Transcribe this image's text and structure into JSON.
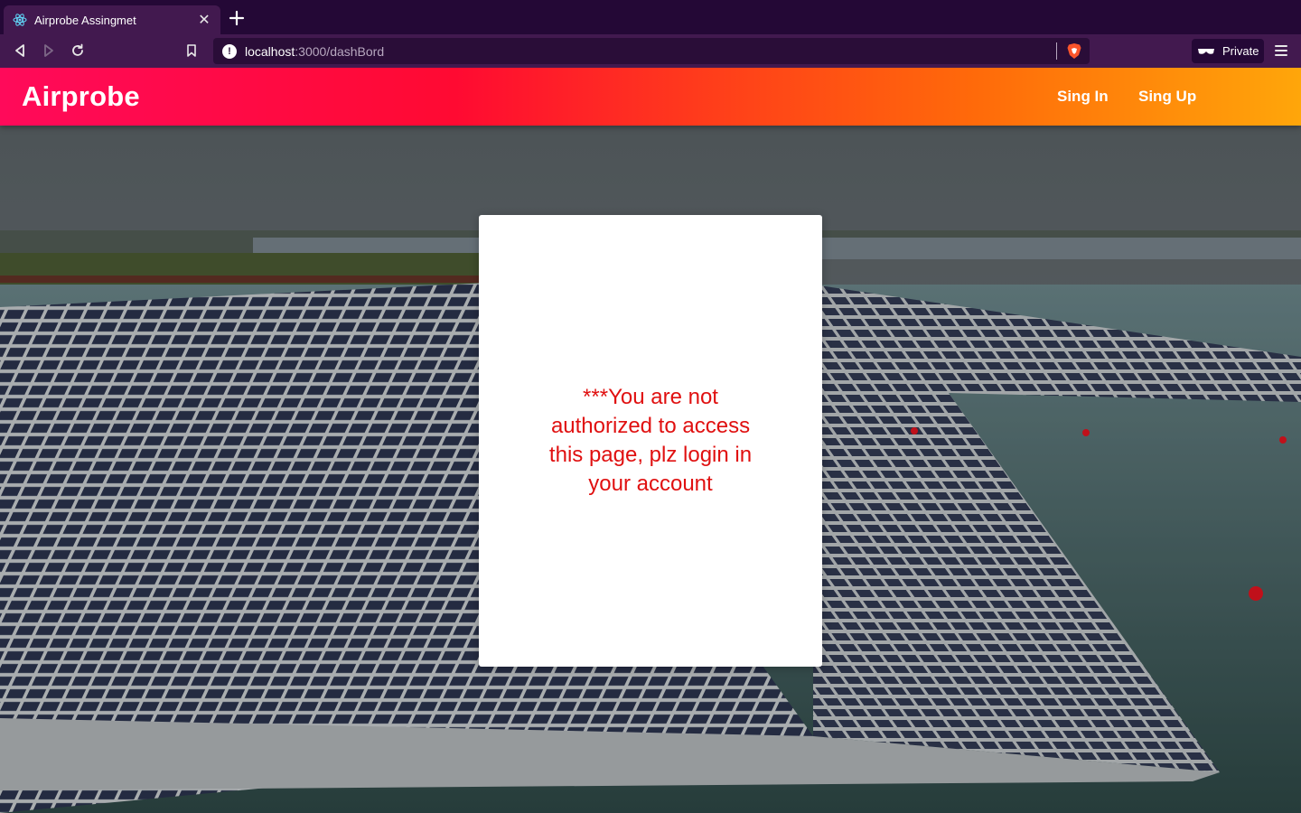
{
  "browser": {
    "tab_title": "Airprobe Assingmet",
    "new_tab_icon": "plus-icon",
    "url_host": "localhost",
    "url_path": ":3000/dashBord",
    "private_label": "Private"
  },
  "navbar": {
    "brand": "Airprobe",
    "links": [
      "Sing In",
      "Sing Up"
    ]
  },
  "card": {
    "message": "***You are not authorized to access this page, plz login in your account"
  },
  "colors": {
    "chrome_bg": "#240836",
    "toolbar_bg": "#42194f",
    "navbar_gradient_start": "#ff0a5a",
    "navbar_gradient_end": "#ffa60a",
    "message_color": "#e01010"
  }
}
